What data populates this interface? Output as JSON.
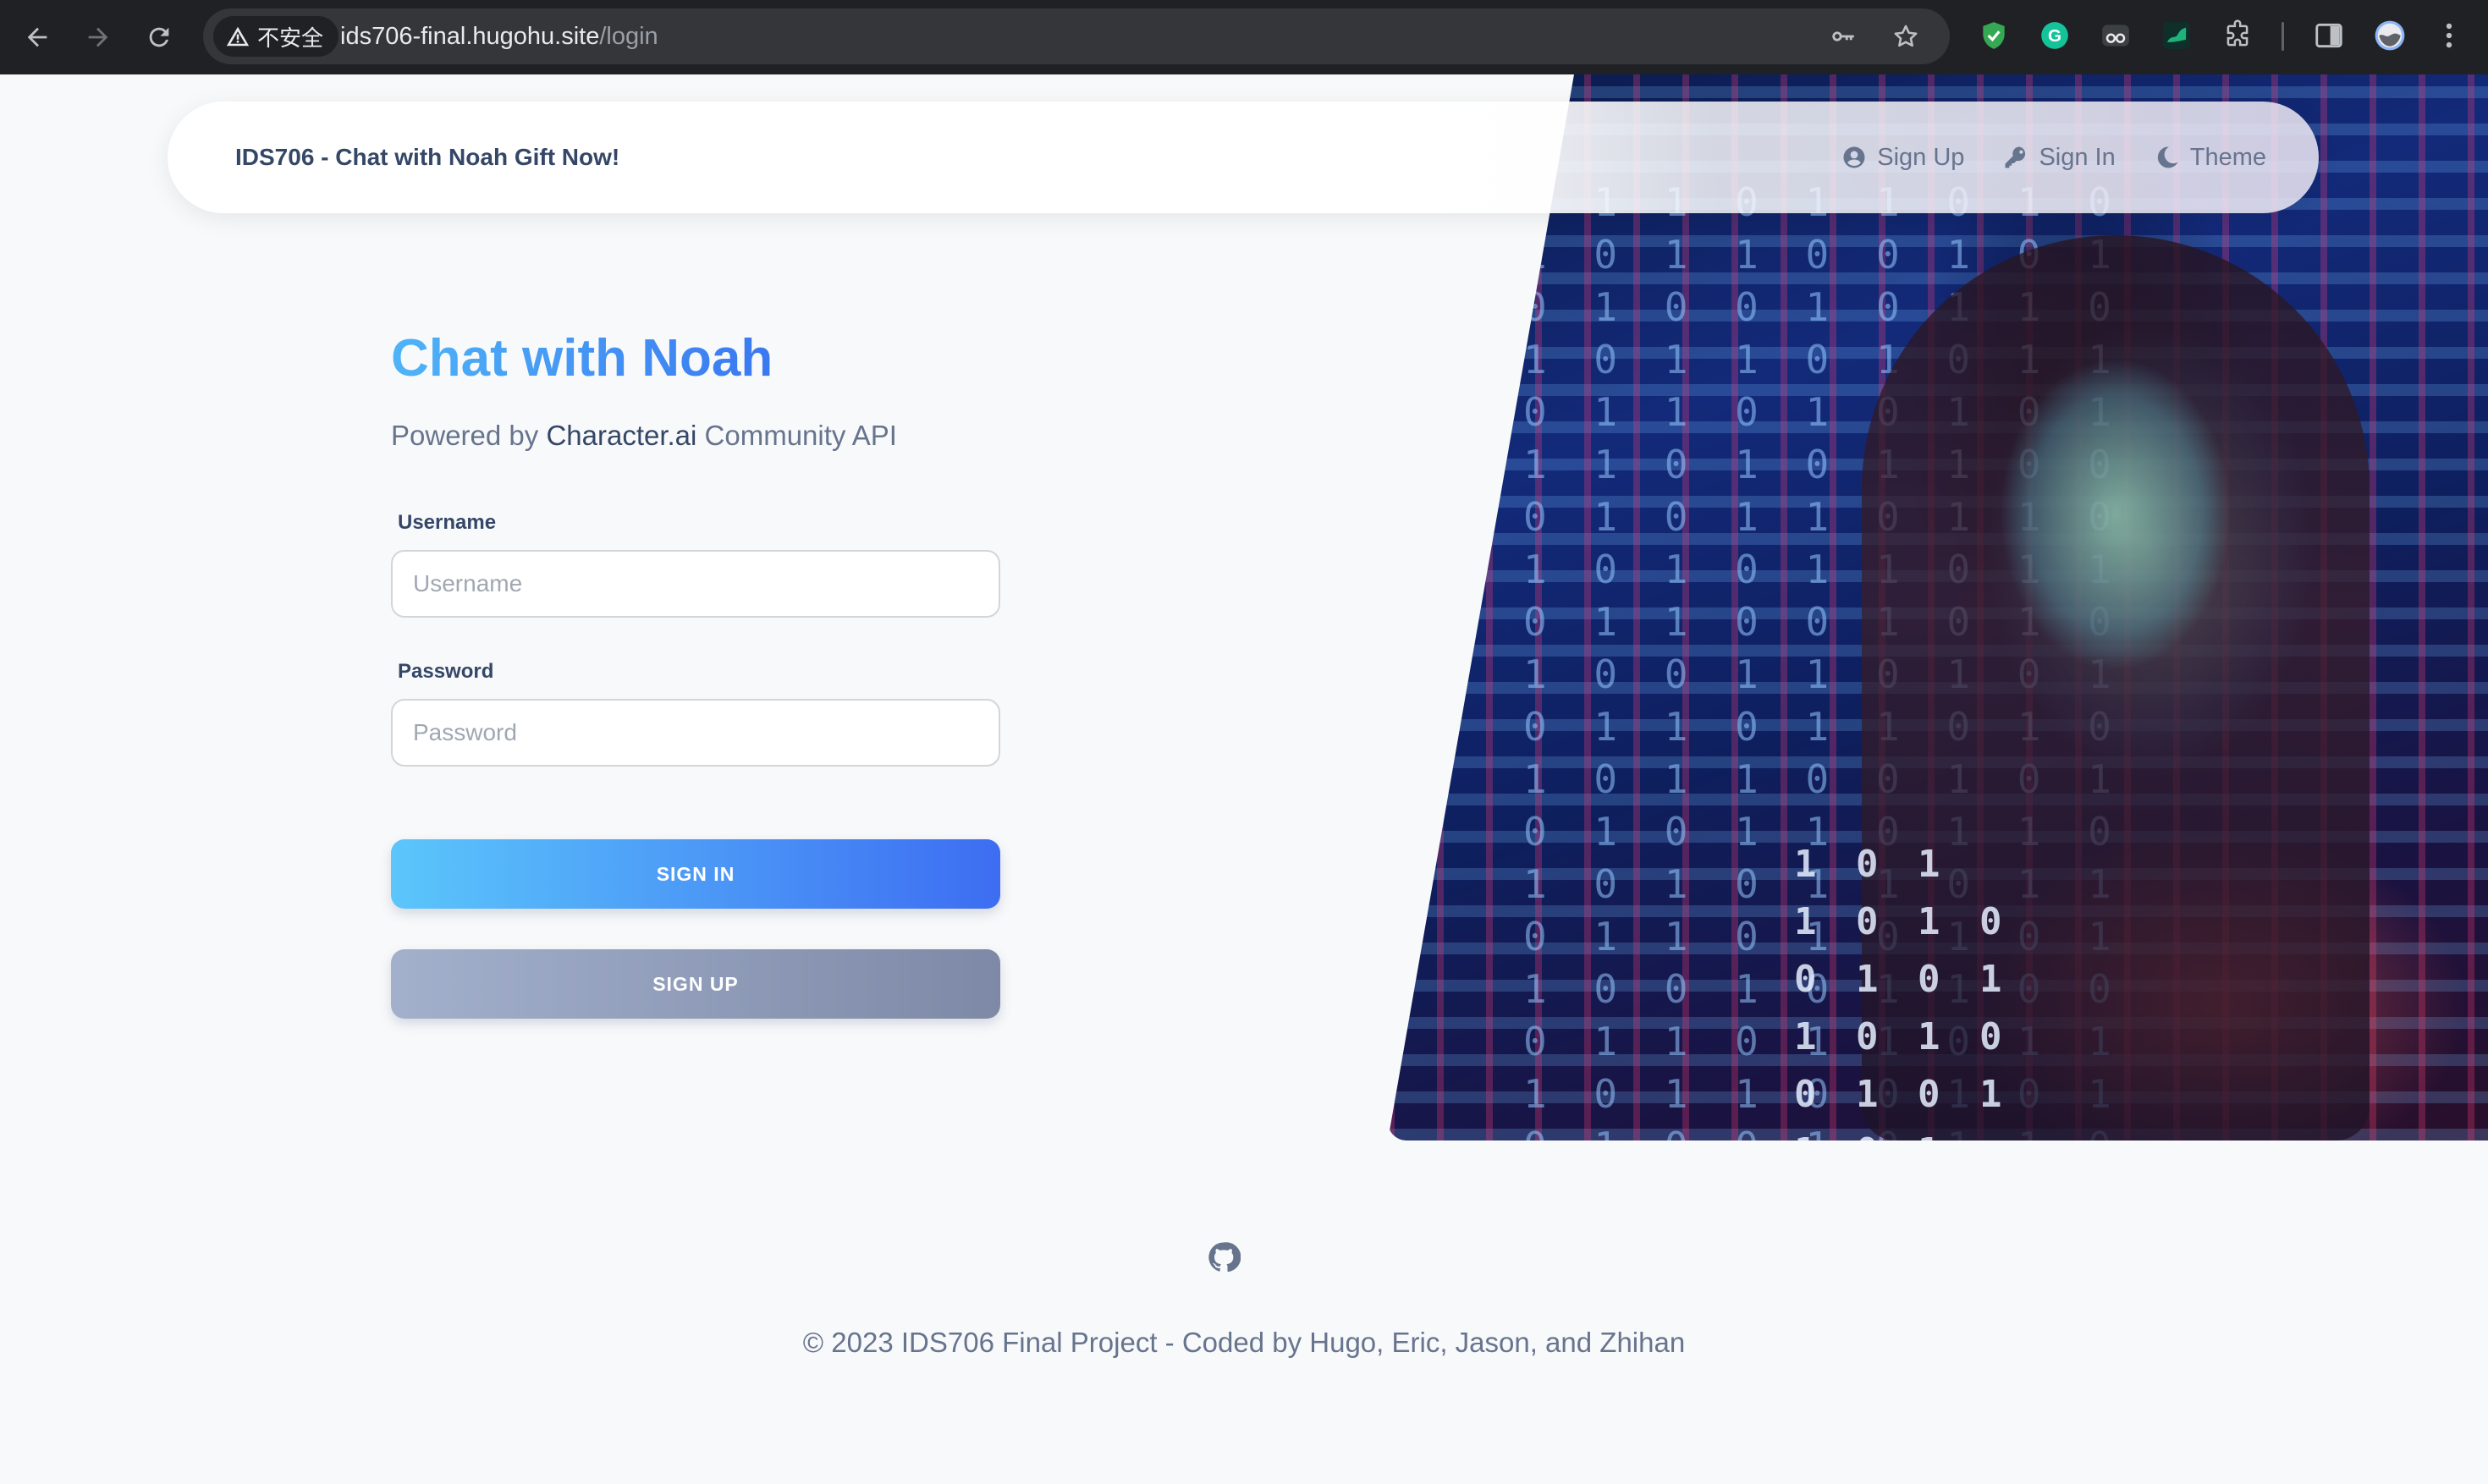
{
  "browser": {
    "security_label": "不安全",
    "url_host": "ids706-final.hugohu.site",
    "url_path": "/login"
  },
  "navbar": {
    "brand": "IDS706 - Chat with Noah Gift Now!",
    "links": [
      {
        "label": "Sign Up",
        "icon": "user-circle-icon"
      },
      {
        "label": "Sign In",
        "icon": "key-icon"
      },
      {
        "label": "Theme",
        "icon": "moon-icon"
      }
    ]
  },
  "login": {
    "title": "Chat with Noah",
    "subtitle_prefix": "Powered by ",
    "subtitle_strong": "Character.ai",
    "subtitle_suffix": " Community API",
    "username_label": "Username",
    "username_placeholder": "Username",
    "password_label": "Password",
    "password_placeholder": "Password",
    "signin_label": "SIGN IN",
    "signup_label": "SIGN UP"
  },
  "footer": {
    "icon": "github-icon",
    "copyright": "© 2023 IDS706 Final Project - Coded by Hugo, Eric, Jason, and Zhihan"
  },
  "colors": {
    "title_gradient_start": "#4fb4f7",
    "title_gradient_end": "#3a78f0",
    "signin_gradient_start": "#5bc6fb",
    "signin_gradient_end": "#3d6df2",
    "signup_gradient_start": "#a3b0cc",
    "signup_gradient_end": "#7d89a6",
    "text_dark": "#344767",
    "text_muted": "#67748e"
  }
}
